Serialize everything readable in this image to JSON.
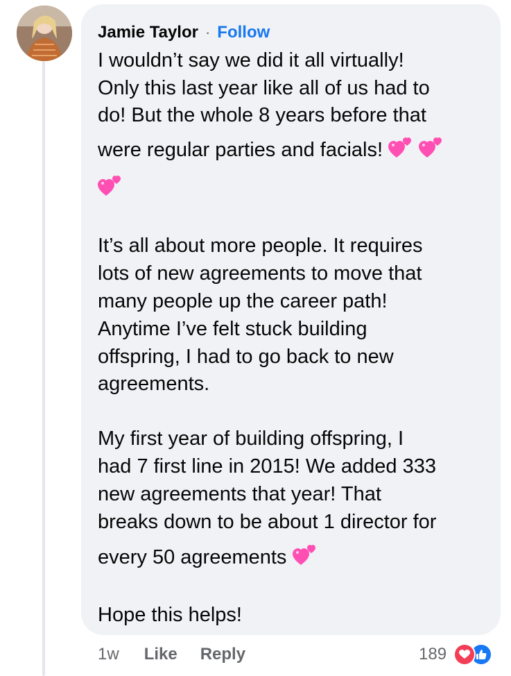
{
  "comment": {
    "author": "Jamie Taylor",
    "separator": "·",
    "follow_label": "Follow",
    "body_lines": [
      "I wouldn’t say we did it all virtually!",
      "Only this last year like all of us had to",
      "do! But the whole 8 years before that",
      "were regular parties and facials!",
      "",
      "It’s all about more people. It requires",
      "lots of new agreements to move that",
      "many people up the career path!",
      "Anytime I’ve felt stuck building",
      "offspring, I had to go back to new",
      "agreements.",
      "My first year of building offspring, I",
      "had 7 first line in 2015!  We added 333",
      "new agreements that year! That",
      "breaks down to be about 1 director for",
      "every 50 agreements",
      "Hope this helps!"
    ],
    "emojis": [
      "two-hearts",
      "two-hearts",
      "two-hearts",
      "two-hearts"
    ]
  },
  "actions": {
    "time": "1w",
    "like_label": "Like",
    "reply_label": "Reply"
  },
  "reactions": {
    "count": "189",
    "types": [
      "love",
      "like"
    ]
  },
  "colors": {
    "bubble": "#f0f2f5",
    "link": "#1877f2",
    "meta_text": "#65676b",
    "emoji_heart": "#ff4fb3",
    "love": "#f33e58",
    "like": "#1877f2",
    "thread_line": "#e4e6eb"
  }
}
